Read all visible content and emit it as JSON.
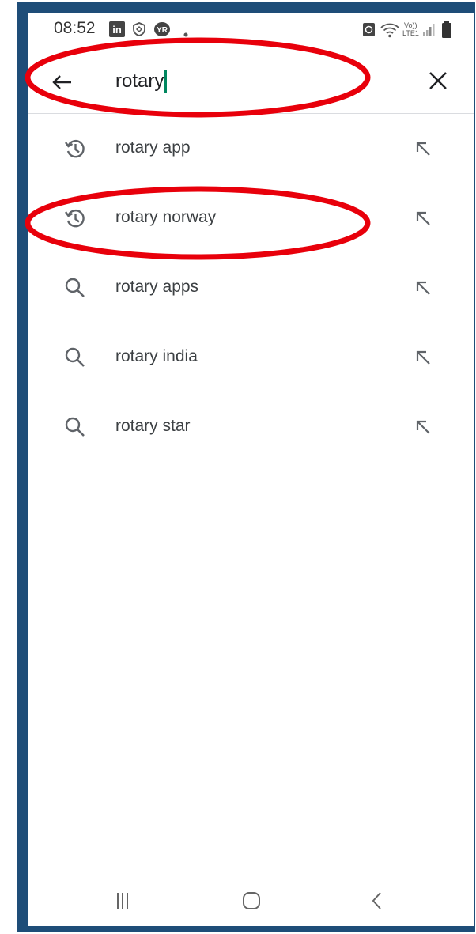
{
  "status_bar": {
    "time": "08:52",
    "icons_left": [
      "linkedin-icon",
      "shield-icon",
      "yr-icon",
      "dot-icon"
    ],
    "icons_right": [
      "data-saver-icon",
      "wifi-icon",
      "volte-icon",
      "signal-icon",
      "battery-icon"
    ],
    "volte_label_top": "Vo))",
    "volte_label_bottom": "LTE1",
    "yr_label": "YR",
    "linkedin_label": "in"
  },
  "search": {
    "query": "rotary",
    "back_icon": "arrow-back-icon",
    "clear_icon": "close-icon"
  },
  "suggestions": [
    {
      "label": "rotary app",
      "type": "history",
      "icon": "history-icon"
    },
    {
      "label": "rotary norway",
      "type": "history",
      "icon": "history-icon"
    },
    {
      "label": "rotary apps",
      "type": "search",
      "icon": "search-icon"
    },
    {
      "label": "rotary india",
      "type": "search",
      "icon": "search-icon"
    },
    {
      "label": "rotary star",
      "type": "search",
      "icon": "search-icon"
    }
  ],
  "nav_bar": {
    "buttons": [
      "recents-icon",
      "home-icon",
      "back-icon"
    ]
  },
  "colors": {
    "frame": "#1e4d78",
    "annotation": "#e8000b",
    "caret": "#01875f",
    "text": "#3c4043",
    "icon": "#5f6368"
  }
}
